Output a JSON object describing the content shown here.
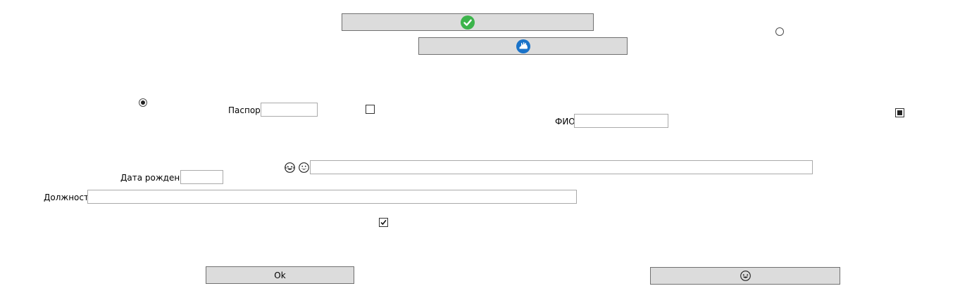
{
  "buttons": {
    "top_confirm": {
      "icon": "green-checkmark-icon"
    },
    "second": {
      "icon": "blue-cloud-icon"
    },
    "ok_label": "Ok",
    "bottom_right": {
      "icon": "laughing-face-icon"
    }
  },
  "fields": {
    "passport": {
      "label": "Паспорт",
      "value": ""
    },
    "fio": {
      "label": "ФИО",
      "value": ""
    },
    "birth_date": {
      "label": "Дата рождения",
      "value": ""
    },
    "position": {
      "label": "Должность",
      "value": ""
    },
    "wide_input": {
      "value": ""
    }
  },
  "controls": {
    "radio_top_right": {
      "checked": false
    },
    "radio_left": {
      "checked": true
    },
    "checkbox_middle": {
      "checked": false
    },
    "checkbox_right": {
      "state": "indeterminate"
    },
    "checkbox_bottom": {
      "checked": true
    }
  },
  "icons": {
    "emoji_1": "laughing-face-icon",
    "emoji_2": "grinning-face-icon"
  },
  "colors": {
    "button_bg": "#dcdcdc",
    "check_green": "#3cb44b",
    "cloud_blue": "#1a73c9"
  }
}
